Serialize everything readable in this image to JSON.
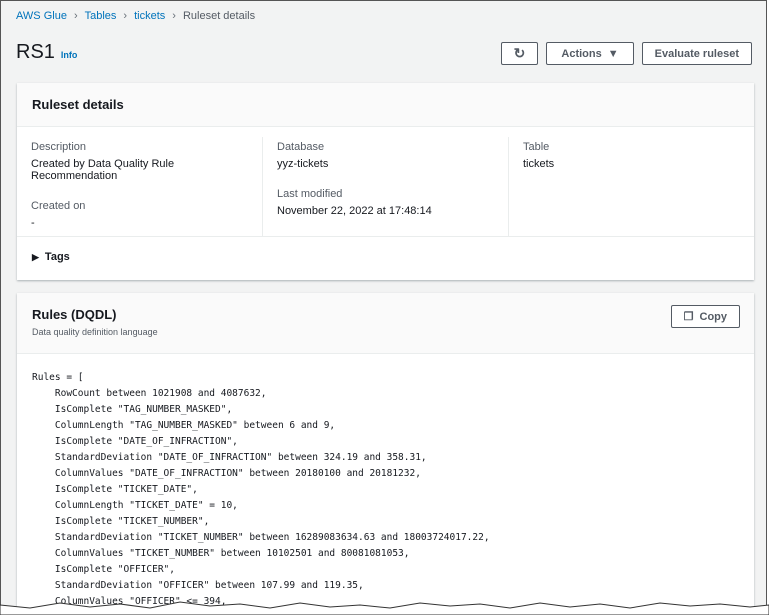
{
  "breadcrumb": [
    "AWS Glue",
    "Tables",
    "tickets",
    "Ruleset details"
  ],
  "title": "RS1",
  "info": "Info",
  "buttons": {
    "refresh": "refresh-icon",
    "actions": "Actions",
    "evaluate": "Evaluate ruleset"
  },
  "details": {
    "heading": "Ruleset details",
    "description_label": "Description",
    "description": "Created by Data Quality Rule Recommendation",
    "created_label": "Created on",
    "created": "-",
    "database_label": "Database",
    "database": "yyz-tickets",
    "modified_label": "Last modified",
    "modified": "November 22, 2022 at 17:48:14",
    "table_label": "Table",
    "table": "tickets",
    "tags": "Tags"
  },
  "rules": {
    "heading": "Rules (DQDL)",
    "subtitle": "Data quality definition language",
    "copy": "Copy",
    "code": "Rules = [\n    RowCount between 1021908 and 4087632,\n    IsComplete \"TAG_NUMBER_MASKED\",\n    ColumnLength \"TAG_NUMBER_MASKED\" between 6 and 9,\n    IsComplete \"DATE_OF_INFRACTION\",\n    StandardDeviation \"DATE_OF_INFRACTION\" between 324.19 and 358.31,\n    ColumnValues \"DATE_OF_INFRACTION\" between 20180100 and 20181232,\n    IsComplete \"TICKET_DATE\",\n    ColumnLength \"TICKET_DATE\" = 10,\n    IsComplete \"TICKET_NUMBER\",\n    StandardDeviation \"TICKET_NUMBER\" between 16289083634.63 and 18003724017.22,\n    ColumnValues \"TICKET_NUMBER\" between 10102501 and 80081081053,\n    IsComplete \"OFFICER\",\n    StandardDeviation \"OFFICER\" between 107.99 and 119.35,\n    ColumnValues \"OFFICER\" <= 394,"
  }
}
